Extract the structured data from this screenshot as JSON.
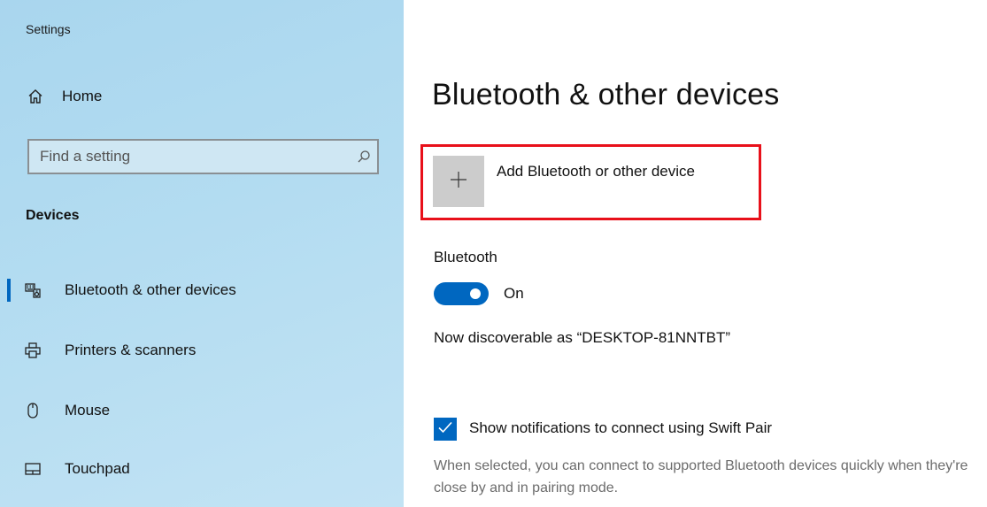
{
  "app": {
    "title": "Settings"
  },
  "sidebar": {
    "home_label": "Home",
    "search": {
      "placeholder": "Find a setting",
      "value": ""
    },
    "section_title": "Devices",
    "items": [
      {
        "label": "Bluetooth & other devices",
        "icon": "bluetooth-devices-icon",
        "selected": true
      },
      {
        "label": "Printers & scanners",
        "icon": "printer-icon",
        "selected": false
      },
      {
        "label": "Mouse",
        "icon": "mouse-icon",
        "selected": false
      },
      {
        "label": "Touchpad",
        "icon": "touchpad-icon",
        "selected": false
      }
    ]
  },
  "main": {
    "title": "Bluetooth & other devices",
    "add_device_label": "Add Bluetooth or other device",
    "bluetooth_heading": "Bluetooth",
    "toggle_state": "On",
    "discoverable_text": "Now discoverable as “DESKTOP-81NNTBT”",
    "swift_pair_label": "Show notifications to connect using Swift Pair",
    "swift_pair_checked": true,
    "swift_pair_help": "When selected, you can connect to supported Bluetooth devices quickly when they're close by and in pairing mode."
  },
  "colors": {
    "accent": "#0067c0",
    "highlight_box": "#e8101a",
    "sidebar_bg": "#b3dcf1",
    "add_tile_bg": "#cccccc",
    "secondary_text": "#6b6b6b"
  }
}
